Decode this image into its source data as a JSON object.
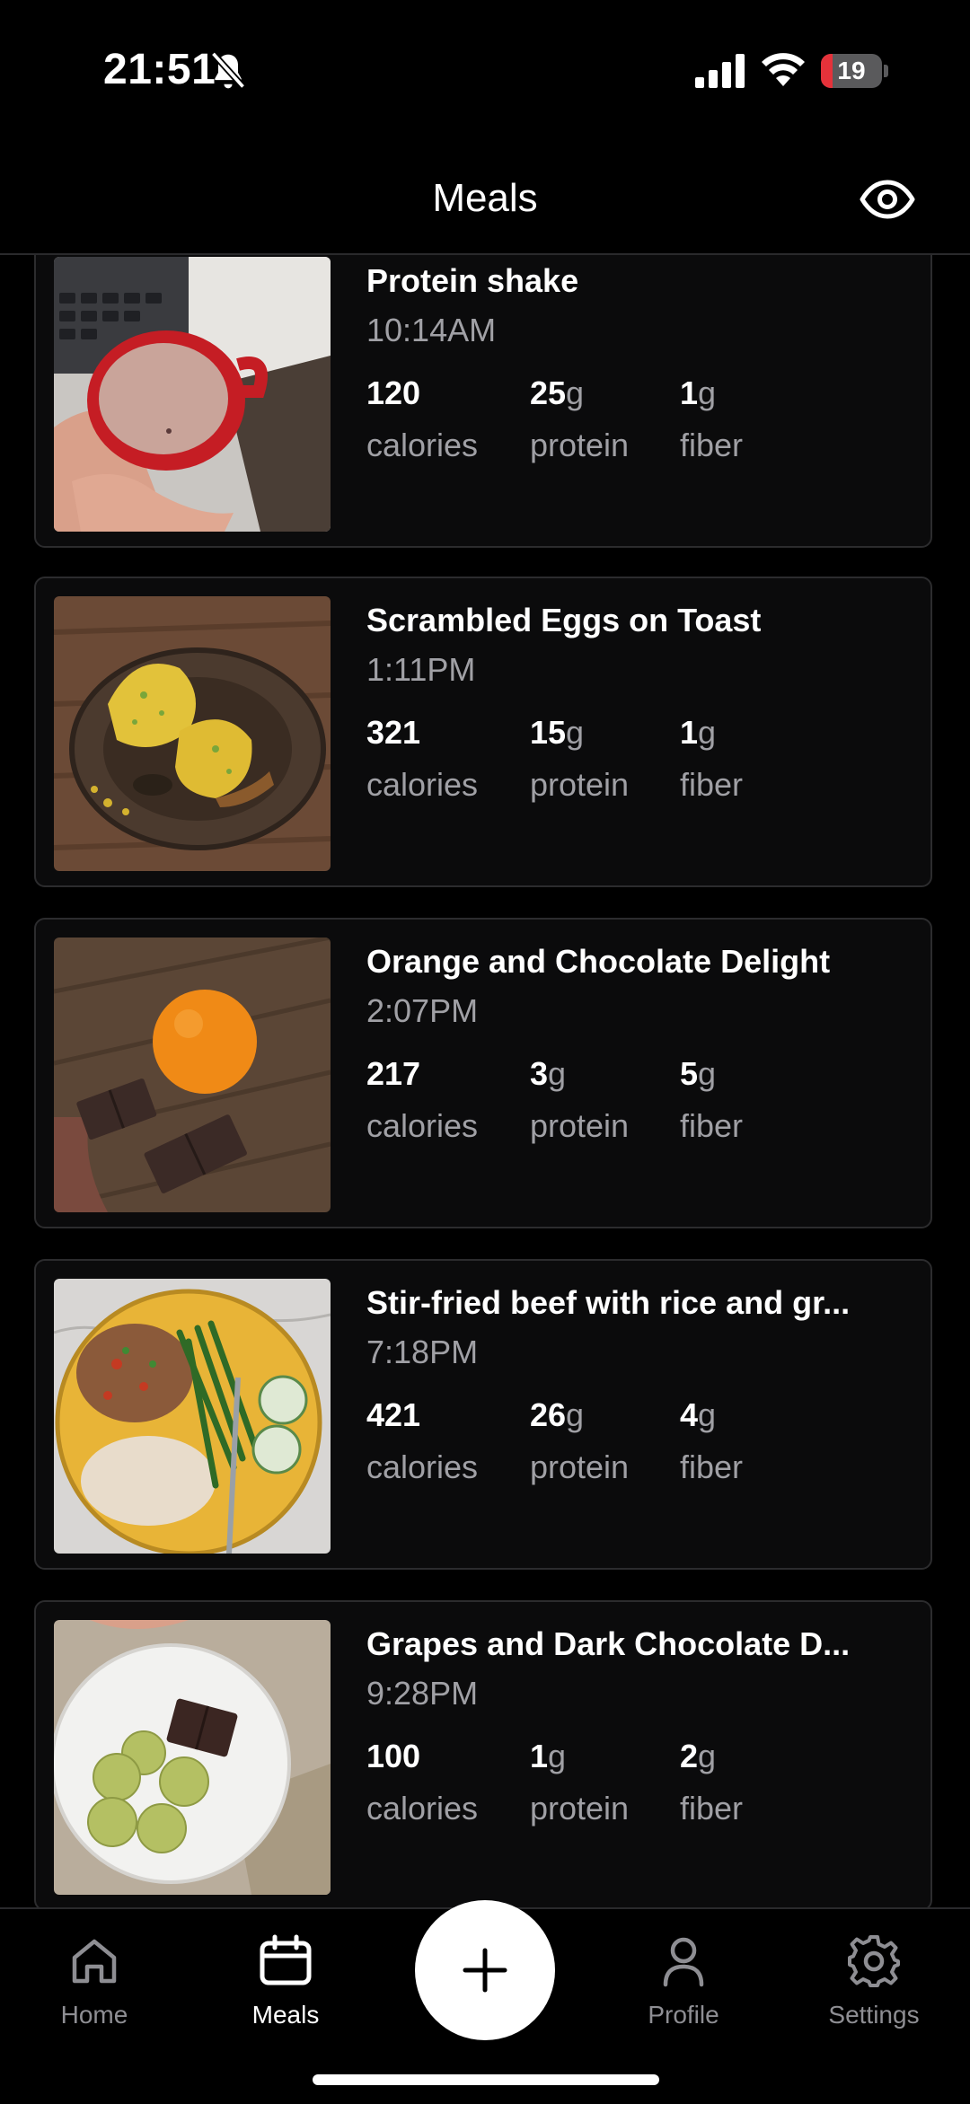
{
  "status_bar": {
    "time": "21:51",
    "battery_level": "19",
    "battery_color": "#e5323a",
    "icons": [
      "bell-slash-icon",
      "cellular-signal-icon",
      "wifi-icon",
      "battery-icon"
    ]
  },
  "header": {
    "title": "Meals",
    "eye_icon": "eye-icon"
  },
  "meals": [
    {
      "name": "Protein shake",
      "time": "10:14AM",
      "calories": "120",
      "protein": "25",
      "fiber": "1"
    },
    {
      "name": "Scrambled Eggs on Toast",
      "time": "1:11PM",
      "calories": "321",
      "protein": "15",
      "fiber": "1"
    },
    {
      "name": "Orange and Chocolate Delight",
      "time": "2:07PM",
      "calories": "217",
      "protein": "3",
      "fiber": "5"
    },
    {
      "name": "Stir-fried beef with rice and gr...",
      "time": "7:18PM",
      "calories": "421",
      "protein": "26",
      "fiber": "4"
    },
    {
      "name": "Grapes and Dark Chocolate D...",
      "time": "9:28PM",
      "calories": "100",
      "protein": "1",
      "fiber": "2"
    }
  ],
  "labels": {
    "unit_g": "g",
    "calories": "calories",
    "protein": "protein",
    "fiber": "fiber"
  },
  "tab_bar": {
    "home": "Home",
    "meals": "Meals",
    "profile": "Profile",
    "settings": "Settings",
    "active": "Meals"
  }
}
